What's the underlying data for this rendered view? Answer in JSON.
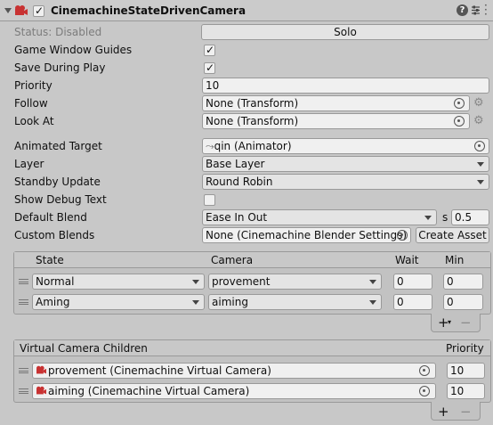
{
  "component": {
    "title": "CinemachineStateDrivenCamera",
    "enabled": true,
    "colors": {
      "accent": "#c83232",
      "background": "#c8c8c8"
    }
  },
  "fields": {
    "status_label": "Status: Disabled",
    "solo_label": "Solo",
    "game_window_guides_label": "Game Window Guides",
    "game_window_guides_checked": true,
    "save_during_play_label": "Save During Play",
    "save_during_play_checked": true,
    "priority_label": "Priority",
    "priority_value": "10",
    "follow_label": "Follow",
    "follow_value": "None (Transform)",
    "look_at_label": "Look At",
    "look_at_value": "None (Transform)",
    "animated_target_label": "Animated Target",
    "animated_target_value": "qin (Animator)",
    "layer_label": "Layer",
    "layer_value": "Base Layer",
    "standby_update_label": "Standby Update",
    "standby_update_value": "Round Robin",
    "show_debug_text_label": "Show Debug Text",
    "show_debug_text_checked": false,
    "default_blend_label": "Default Blend",
    "default_blend_value": "Ease In Out",
    "default_blend_time_label": "s",
    "default_blend_time_value": "0.5",
    "custom_blends_label": "Custom Blends",
    "custom_blends_value": "None (Cinemachine Blender Settings)",
    "create_asset_label": "Create Asset"
  },
  "instructions": {
    "columns": {
      "state": "State",
      "camera": "Camera",
      "wait": "Wait",
      "min": "Min"
    },
    "rows": [
      {
        "state": "Normal",
        "camera": "provement",
        "wait": "0",
        "min": "0"
      },
      {
        "state": "Aming",
        "camera": "aiming",
        "wait": "0",
        "min": "0"
      }
    ],
    "add_label": "+",
    "add_dropdown_label": "▾",
    "remove_label": "−"
  },
  "children": {
    "header": "Virtual Camera Children",
    "priority_header": "Priority",
    "rows": [
      {
        "name": "provement (Cinemachine Virtual Camera)",
        "priority": "10"
      },
      {
        "name": "aiming (Cinemachine Virtual Camera)",
        "priority": "10"
      }
    ],
    "add_label": "+",
    "remove_label": "−"
  },
  "icons": {
    "foldout": "foldout-triangle-icon",
    "component": "cinemachine-camera-icon",
    "help": "help-icon",
    "presets": "presets-icon",
    "menu": "kebab-menu-icon",
    "object_picker": "object-picker-icon",
    "settings": "gear-icon"
  }
}
